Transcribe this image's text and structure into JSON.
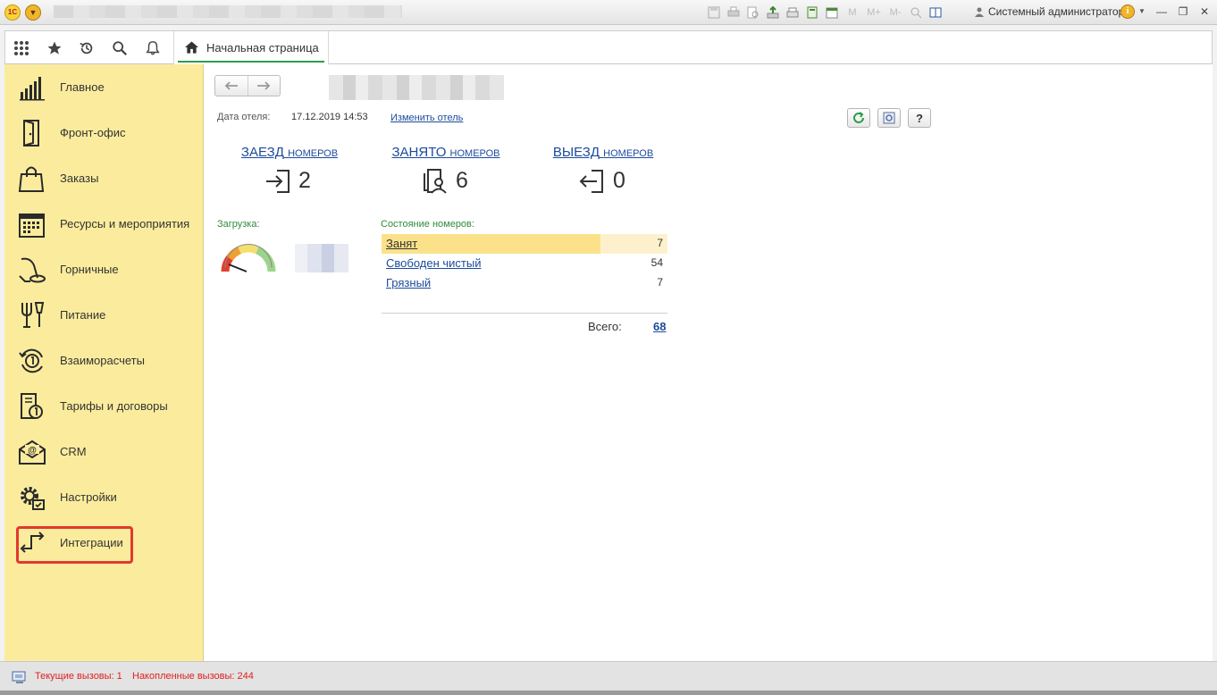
{
  "titlebar": {
    "user": "Системный администратор",
    "user_icon": "user-icon",
    "m_buttons": [
      "M",
      "M+",
      "M-"
    ]
  },
  "navbar": {
    "home_tab": "Начальная страница"
  },
  "sidebar": {
    "items": [
      {
        "label": "Главное",
        "icon": "chart-bars-icon"
      },
      {
        "label": "Фронт-офис",
        "icon": "door-icon"
      },
      {
        "label": "Заказы",
        "icon": "shopping-bag-icon"
      },
      {
        "label": "Ресурсы и мероприятия",
        "icon": "calendar-icon"
      },
      {
        "label": "Горничные",
        "icon": "vacuum-icon"
      },
      {
        "label": "Питание",
        "icon": "fork-glass-icon"
      },
      {
        "label": "Взаиморасчеты",
        "icon": "coin-cycle-icon"
      },
      {
        "label": "Тарифы и договоры",
        "icon": "contract-icon"
      },
      {
        "label": "CRM",
        "icon": "envelope-at-icon"
      },
      {
        "label": "Настройки",
        "icon": "settings-icon"
      },
      {
        "label": "Интеграции",
        "icon": "integration-arrows-icon"
      }
    ]
  },
  "main": {
    "date_label": "Дата отеля:",
    "date_value": "17.12.2019 14:53",
    "change_hotel": "Изменить отель",
    "help_label": "?",
    "counters": [
      {
        "title": "ЗАЕЗД",
        "suffix": "номеров",
        "value": "2"
      },
      {
        "title": "ЗАНЯТО",
        "suffix": "номеров",
        "value": "6"
      },
      {
        "title": "ВЫЕЗД",
        "suffix": "номеров",
        "value": "0"
      }
    ],
    "load_label": "Загрузка:",
    "state_label": "Состояние номеров:",
    "states": [
      {
        "name": "Занят",
        "count": "7"
      },
      {
        "name": "Свободен чистый",
        "count": "54"
      },
      {
        "name": "Грязный",
        "count": "7"
      }
    ],
    "total_label": "Всего:",
    "total_value": "68"
  },
  "statusbar": {
    "current_calls": "Текущие вызовы: 1",
    "accumulated_calls": "Накопленные вызовы: 244"
  },
  "colors": {
    "sidebar_bg": "#fbec9d",
    "link": "#1c4b9c",
    "accent_green": "#2e9c4a",
    "highlight_red": "#e2382f",
    "status_red": "#e02020"
  }
}
